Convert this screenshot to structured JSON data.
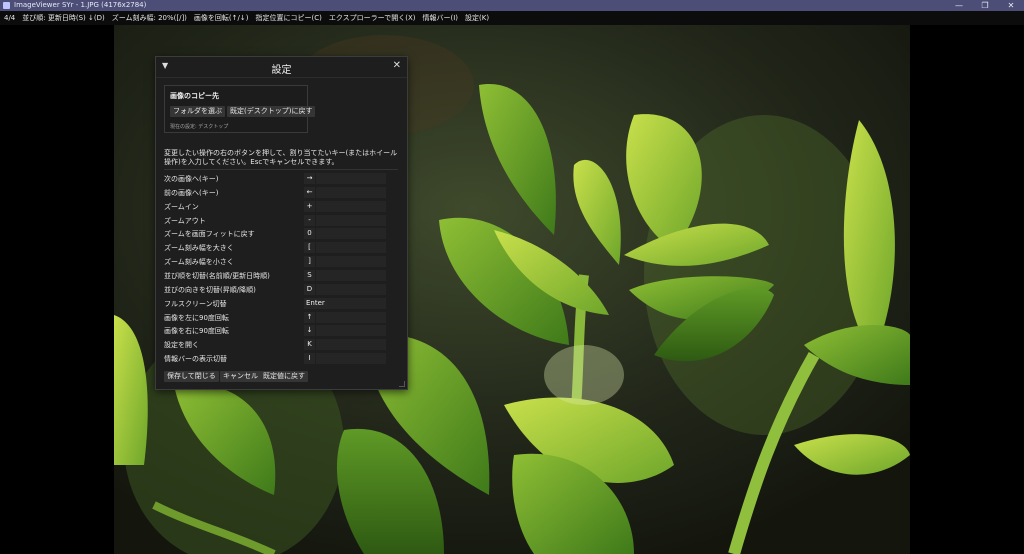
{
  "window": {
    "title": "ImageViewer SYr - 1.JPG (4176x2784)",
    "minimize_glyph": "—",
    "restore_glyph": "❐",
    "close_glyph": "✕"
  },
  "menubar": {
    "items": [
      "4/4",
      "並び順: 更新日時(S) ↓(D)",
      "ズーム刻み幅: 20%([/])",
      "画像を回転(↑/↓)",
      "指定位置にコピー(C)",
      "エクスプローラーで開く(X)",
      "情報バー(I)",
      "設定(K)"
    ]
  },
  "dialog": {
    "title": "設定",
    "collapse_glyph": "▼",
    "close_glyph": "✕",
    "copy_group": {
      "title": "画像のコピー先",
      "choose_folder": "フォルダを選ぶ",
      "reset_default": "既定(デスクトップ)に戻す",
      "current": "現在の設定: デスクトップ"
    },
    "description": "変更したい操作の右のボタンを押して、割り当てたいキー(またはホイール操作)を入力してください。Escでキャンセルできます。",
    "keybinds": [
      {
        "label": "次の画像へ(キー)",
        "key": "→"
      },
      {
        "label": "前の画像へ(キー)",
        "key": "←"
      },
      {
        "label": "ズームイン",
        "key": "+"
      },
      {
        "label": "ズームアウト",
        "key": "-"
      },
      {
        "label": "ズームを画面フィットに戻す",
        "key": "0"
      },
      {
        "label": "ズーム刻み幅を大きく",
        "key": "["
      },
      {
        "label": "ズーム刻み幅を小さく",
        "key": "]"
      },
      {
        "label": "並び順を切替(名前順/更新日時順)",
        "key": "S"
      },
      {
        "label": "並びの向きを切替(昇順/降順)",
        "key": "D"
      },
      {
        "label": "フルスクリーン切替",
        "key": "Enter"
      },
      {
        "label": "画像を左に90度回転",
        "key": "↑"
      },
      {
        "label": "画像を右に90度回転",
        "key": "↓"
      },
      {
        "label": "設定を開く",
        "key": "K"
      },
      {
        "label": "情報バーの表示切替",
        "key": "I"
      }
    ],
    "footer": {
      "save": "保存して閉じる",
      "cancel": "キャンセル",
      "defaults": "既定値に戻す"
    }
  },
  "colors": {
    "titlebar": "#4d4e78",
    "dialog_bg": "#1e1e1e",
    "leaf_light": "#b5d23a",
    "leaf_dark": "#4f8a1f"
  }
}
